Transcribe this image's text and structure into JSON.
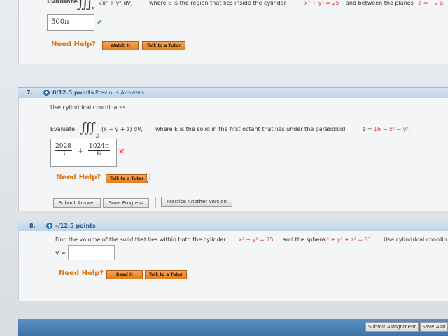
{
  "q6": {
    "evaluate_label": "Evaluate",
    "integral_sign": "∭",
    "subscript": "E",
    "integrand": "√x² + y² dV,",
    "where_text": "where E is the region that lies inside the cylinder",
    "cyl_eq": "x² + y² = 25",
    "between_text": "and between the planes",
    "plane_eq": "z = −2 a",
    "answer": "500π",
    "check_icon": "✔",
    "need_help": "Need Help?",
    "watch_button": "Watch It",
    "tutor_button": "Talk to a Tutor"
  },
  "q7": {
    "number": "7.",
    "plus": "+",
    "points": "0/12.5 points",
    "separator": "|",
    "previous_answers": "Previous Answers",
    "instruction": "Use cylindrical coordinates.",
    "evaluate_label": "Evaluate",
    "integral_sign": "∭",
    "subscript": "E",
    "integrand": "(x + y + z) dV,",
    "where_text": "where E is the solid in the first octant that lies under the paraboloid",
    "paraboloid_lhs": "z =",
    "paraboloid_rhs": "16 − x² − y².",
    "answer_frac1_num": "2028",
    "answer_frac1_den": "3",
    "answer_plus": "+",
    "answer_frac2_num": "1024π",
    "answer_frac2_den": "6",
    "cross_icon": "✕",
    "need_help": "Need Help?",
    "tutor_button": "Talk to a Tutor",
    "submit_button": "Submit Answer",
    "save_button": "Save Progress",
    "practice_button": "Practice Another Version"
  },
  "q8": {
    "number": "8.",
    "plus": "+",
    "points": "–/12.5 points",
    "text_1": "Find the volume of the solid that lies within both the cylinder",
    "cyl_eq": "x² + y² = 25",
    "text_2": "and the sphere",
    "sphere_eq": "x² + y² + z² = 81.",
    "text_3": "Use cylindrical coordin",
    "v_label": "V =",
    "v_value": "",
    "need_help": "Need Help?",
    "read_button": "Read It",
    "tutor_button": "Talk to a Tutor"
  },
  "footer": {
    "submit_assignment": "Submit Assignment",
    "save_assignment": "Save Assi"
  }
}
